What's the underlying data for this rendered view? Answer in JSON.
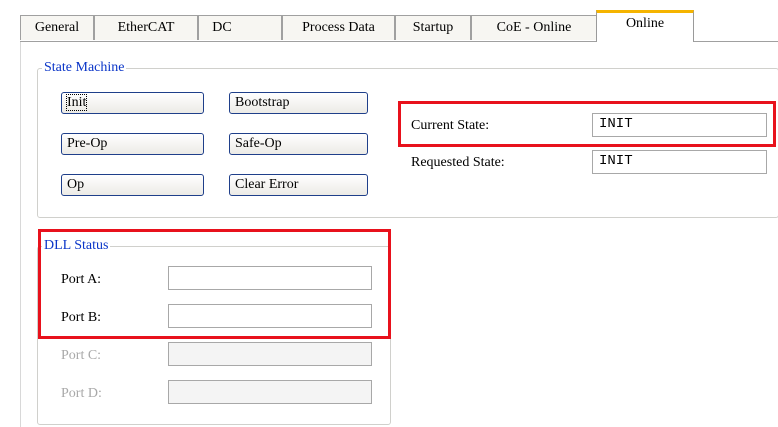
{
  "tabs": [
    {
      "label": "General",
      "active": false
    },
    {
      "label": "EtherCAT",
      "active": false
    },
    {
      "label": "DC",
      "active": false
    },
    {
      "label": "Process Data",
      "active": false
    },
    {
      "label": "Startup",
      "active": false
    },
    {
      "label": "CoE - Online",
      "active": false
    },
    {
      "label": "Online",
      "active": true
    }
  ],
  "state_machine": {
    "title": "State Machine",
    "buttons": {
      "init": "Init",
      "bootstrap": "Bootstrap",
      "pre_op": "Pre-Op",
      "safe_op": "Safe-Op",
      "op": "Op",
      "clear_error": "Clear Error"
    },
    "current_state_label": "Current State:",
    "current_state_value": "INIT",
    "requested_state_label": "Requested State:",
    "requested_state_value": "INIT"
  },
  "dll_status": {
    "title": "DLL Status",
    "ports": [
      {
        "label": "Port A:",
        "value": "",
        "enabled": true
      },
      {
        "label": "Port B:",
        "value": "",
        "enabled": true
      },
      {
        "label": "Port C:",
        "value": "",
        "enabled": false
      },
      {
        "label": "Port D:",
        "value": "",
        "enabled": false
      }
    ]
  },
  "colors": {
    "highlight": "#e8111c",
    "group_title": "#0a35c8",
    "active_tab_accent": "#f5b400"
  }
}
